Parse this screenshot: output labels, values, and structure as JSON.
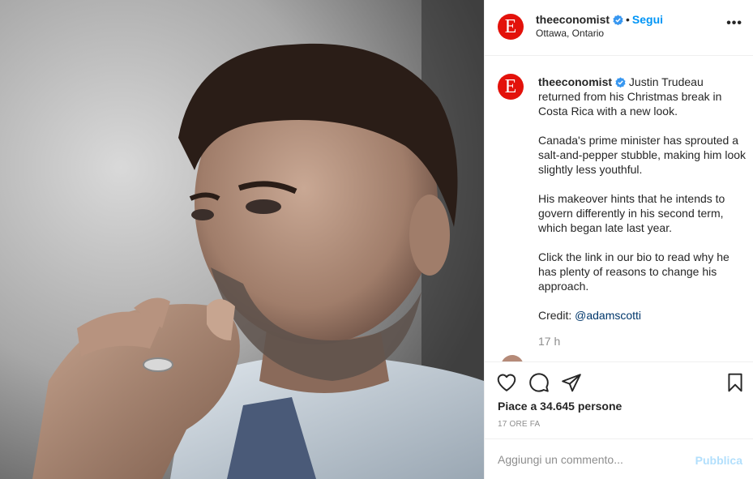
{
  "account": {
    "username": "theeconomist",
    "logo_letter": "E",
    "brand_color": "#e3120b",
    "separator": "•",
    "follow_label": "Segui",
    "location": "Ottawa, Ontario"
  },
  "caption": {
    "username": "theeconomist",
    "paragraphs": [
      "Justin Trudeau returned from his Christmas break in Costa Rica with a new look.",
      "Canada's prime minister has sprouted a salt-and-pepper stubble, making him look slightly less youthful.",
      "His makeover hints that he intends to govern differently in his second term, which began late last year.",
      "Click the link in our bio to read why he has plenty of reasons to change his approach."
    ],
    "credit_prefix": "Credit: ",
    "credit_handle": "@adamscotti",
    "time_ago": "17 h"
  },
  "actions": {
    "likes_text": "Piace a 34.645 persone",
    "post_date": "17 ORE FA"
  },
  "comment": {
    "placeholder": "Aggiungi un commento...",
    "publish_label": "Pubblica"
  },
  "colors": {
    "link_blue": "#0095f6",
    "verified_blue": "#3897f0",
    "muted": "#8e8e8e"
  }
}
